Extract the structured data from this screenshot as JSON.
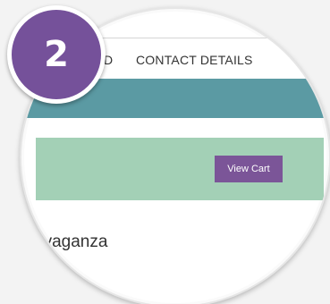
{
  "badge": {
    "number": "2",
    "color": "#75519a"
  },
  "steps": {
    "previous_partial": "D",
    "current": "CONTACT DETAILS"
  },
  "cart": {
    "button_label": "View Cart",
    "bar_color": "#a3d0b6",
    "button_color": "#7b5598"
  },
  "band": {
    "color": "#5b9aa3"
  },
  "product": {
    "title_partial": "avaganza"
  }
}
